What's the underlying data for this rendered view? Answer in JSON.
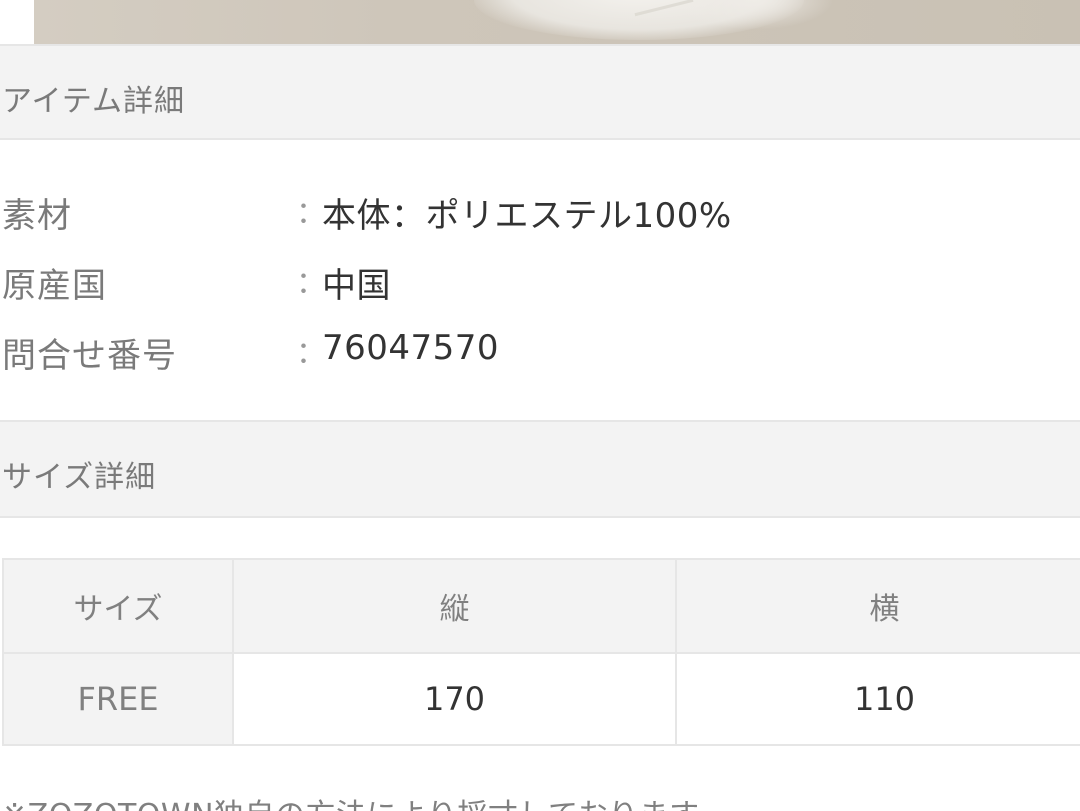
{
  "item_details": {
    "header": "アイテム詳細",
    "rows": [
      {
        "label": "素材",
        "colon": "：",
        "value": "本体：ポリエステル100%"
      },
      {
        "label": "原産国",
        "colon": "：",
        "value": "中国"
      },
      {
        "label": "問合せ番号",
        "colon": "：",
        "value": "76047570"
      }
    ]
  },
  "size_details": {
    "header": "サイズ詳細",
    "table": {
      "columns": [
        "サイズ",
        "縦",
        "横"
      ],
      "rows": [
        [
          "FREE",
          "170",
          "110"
        ]
      ]
    }
  },
  "footnote": "※ZOZOTOWN独自の方法により採寸しております。",
  "colors": {
    "header_bg": "#f3f3f3",
    "border": "#e6e6e6",
    "label_text": "#7a7a7a",
    "value_text": "#333333"
  }
}
